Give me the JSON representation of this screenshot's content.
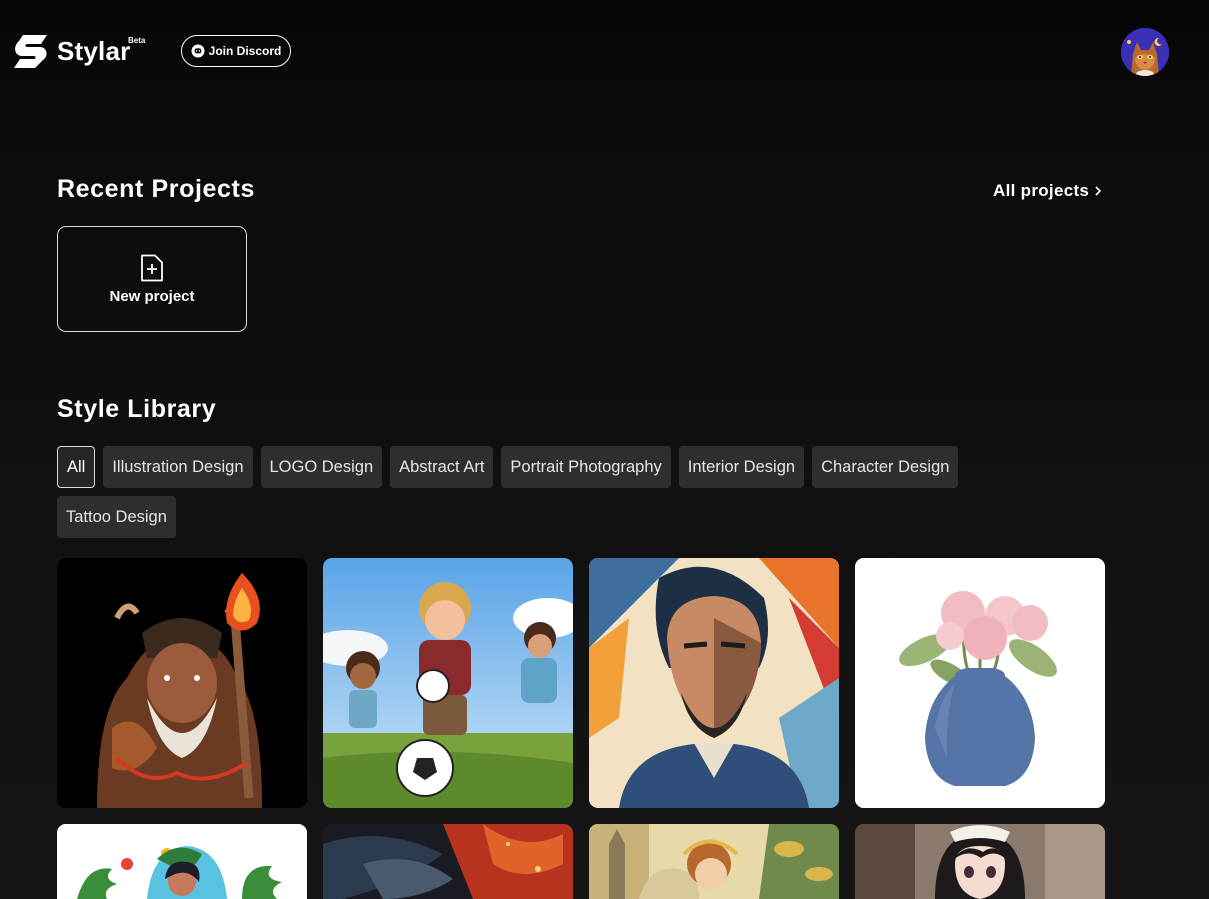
{
  "brand": {
    "name": "Stylar",
    "badge": "Beta"
  },
  "header": {
    "discord_label": "Join Discord",
    "avatar_icon": "cat-avatar"
  },
  "recent": {
    "title": "Recent Projects",
    "all_link": "All projects",
    "new_project_label": "New project"
  },
  "library": {
    "title": "Style Library",
    "filters": [
      {
        "label": "All",
        "active": true
      },
      {
        "label": "Illustration Design",
        "active": false
      },
      {
        "label": "LOGO Design",
        "active": false
      },
      {
        "label": "Abstract Art",
        "active": false
      },
      {
        "label": "Portrait Photography",
        "active": false
      },
      {
        "label": "Interior Design",
        "active": false
      },
      {
        "label": "Character Design",
        "active": false
      },
      {
        "label": "Tattoo Design",
        "active": false
      }
    ],
    "cards": [
      {
        "subject": "viking-warrior-with-torch"
      },
      {
        "subject": "kids-playing-soccer"
      },
      {
        "subject": "geometric-man-portrait"
      },
      {
        "subject": "pink-flowers-blue-vase"
      },
      {
        "subject": "tropical-woman-illustration"
      },
      {
        "subject": "fiery-creature"
      },
      {
        "subject": "art-nouveau-woman"
      },
      {
        "subject": "anime-maid-girl"
      }
    ]
  },
  "colors": {
    "background": "#0b0b0b",
    "chip": "#2e2e2e",
    "text": "#ffffff"
  }
}
